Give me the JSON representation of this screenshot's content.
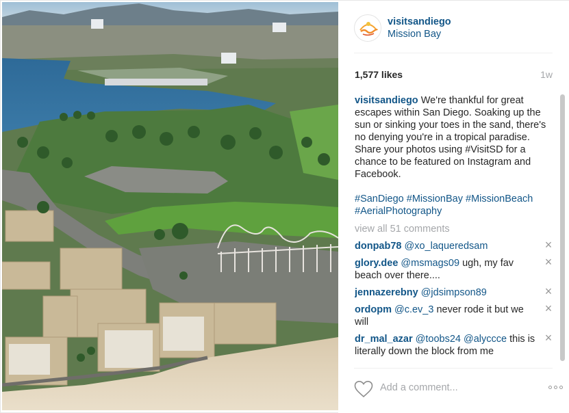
{
  "post": {
    "username": "visitsandiego",
    "location": "Mission Bay",
    "avatar_text": "San Diego",
    "likes": "1,577 likes",
    "age": "1w"
  },
  "caption": {
    "author": "visitsandiego",
    "text": " We're thankful for great escapes within San Diego. Soaking up the sun or sinking your toes in the sand, there's no denying you're in a tropical paradise.\nShare your photos using #VisitSD for a chance to be featured on Instagram and Facebook.",
    "hashtags": "#SanDiego #MissionBay #MissionBeach #AerialPhotography"
  },
  "view_all": "view all 51 comments",
  "comments": [
    {
      "user": "donpab78",
      "mention": " @xo_laqueredsam",
      "text": ""
    },
    {
      "user": "glory.dee",
      "mention": " @msmags09",
      "text": " ugh, my fav beach over there...."
    },
    {
      "user": "jennazerebny",
      "mention": " @jdsimpson89",
      "text": ""
    },
    {
      "user": "ordopm",
      "mention": " @c.ev_3",
      "text": " never rode it but we will"
    },
    {
      "user": "dr_mal_azar",
      "mention": " @toobs24 @alyccce",
      "text": " this is literally down the block from me"
    }
  ],
  "footer": {
    "comment_placeholder": "Add a comment..."
  },
  "icons": {
    "like": "heart-icon",
    "remove_comment": "close-icon",
    "more": "more-options-icon"
  },
  "colors": {
    "link_blue": "#125688",
    "muted_gray": "#a5a7aa",
    "text_dark": "#262626"
  }
}
